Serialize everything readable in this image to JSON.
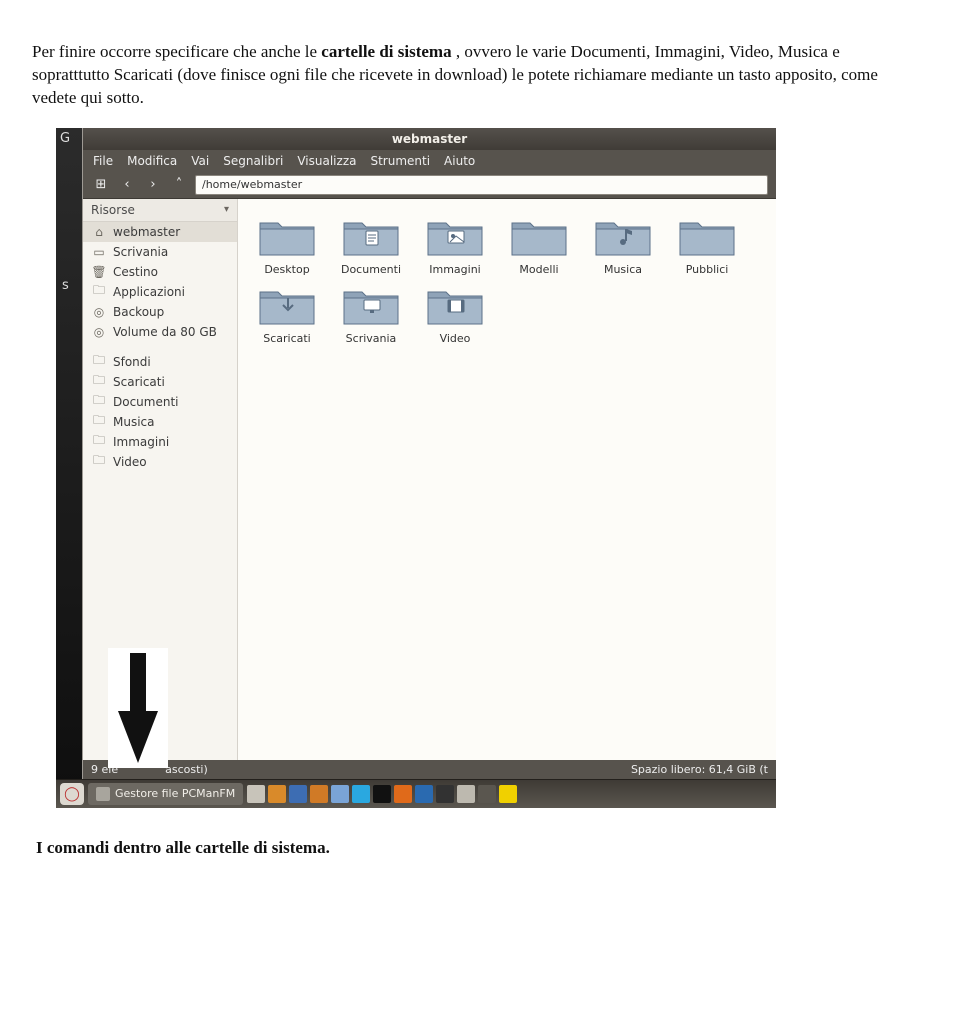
{
  "doc": {
    "p1_a": "Per finire occorre specificare che anche le ",
    "p1_bold": "cartelle di sistema",
    "p1_b": ", ovvero le varie Documenti, Immagini, Video, Musica e sopratttutto Scaricati (dove finisce ogni file che ricevete in download) le potete richiamare mediante un tasto apposito, come vedete qui sotto.",
    "footer": "I comandi dentro alle cartelle di sistema."
  },
  "fm": {
    "title": "webmaster",
    "menu": [
      "File",
      "Modifica",
      "Vai",
      "Segnalibri",
      "Visualizza",
      "Strumenti",
      "Aiuto"
    ],
    "path": "/home/webmaster",
    "sidebar": {
      "header": "Risorse",
      "items": [
        {
          "icon": "home",
          "label": "webmaster",
          "sel": true
        },
        {
          "icon": "desktop",
          "label": "Scrivania"
        },
        {
          "icon": "trash",
          "label": "Cestino"
        },
        {
          "icon": "folder",
          "label": "Applicazioni"
        },
        {
          "icon": "disk",
          "label": "Backoup"
        },
        {
          "icon": "disk",
          "label": "Volume da 80 GB"
        },
        {
          "icon": "sep",
          "label": ""
        },
        {
          "icon": "folder",
          "label": "Sfondi"
        },
        {
          "icon": "folder",
          "label": "Scaricati"
        },
        {
          "icon": "folder",
          "label": "Documenti"
        },
        {
          "icon": "folder",
          "label": "Musica"
        },
        {
          "icon": "folder",
          "label": "Immagini"
        },
        {
          "icon": "folder",
          "label": "Video"
        }
      ]
    },
    "files": [
      {
        "label": "Desktop",
        "glyph": ""
      },
      {
        "label": "Documenti",
        "glyph": "doc"
      },
      {
        "label": "Immagini",
        "glyph": "img"
      },
      {
        "label": "Modelli",
        "glyph": ""
      },
      {
        "label": "Musica",
        "glyph": "music"
      },
      {
        "label": "Pubblici",
        "glyph": ""
      },
      {
        "label": "Scaricati",
        "glyph": "down"
      },
      {
        "label": "Scrivania",
        "glyph": "desk"
      },
      {
        "label": "Video",
        "glyph": "video"
      }
    ],
    "status_left": "9 ele",
    "status_mid": "ascosti)",
    "status_right": "Spazio libero: 61,4 GiB (t",
    "desk_badge": "G",
    "desk_side": "s"
  },
  "taskbar": {
    "app_label": "Gestore file PCManFM",
    "icons": [
      {
        "name": "pager",
        "bg": "#c8c4ba"
      },
      {
        "name": "browser",
        "bg": "#d98a2a"
      },
      {
        "name": "mail",
        "bg": "#3d6db3"
      },
      {
        "name": "chat",
        "bg": "#d07a26"
      },
      {
        "name": "people",
        "bg": "#7aa4d6"
      },
      {
        "name": "skype",
        "bg": "#2aa8e0"
      },
      {
        "name": "terminal",
        "bg": "#111111"
      },
      {
        "name": "burner",
        "bg": "#e06a1a"
      },
      {
        "name": "media",
        "bg": "#2a6ab0"
      },
      {
        "name": "record",
        "bg": "#323232"
      },
      {
        "name": "settings",
        "bg": "#bdb9af"
      },
      {
        "name": "volume",
        "bg": "#5a564f"
      },
      {
        "name": "monitor",
        "bg": "#f0d000"
      }
    ]
  }
}
